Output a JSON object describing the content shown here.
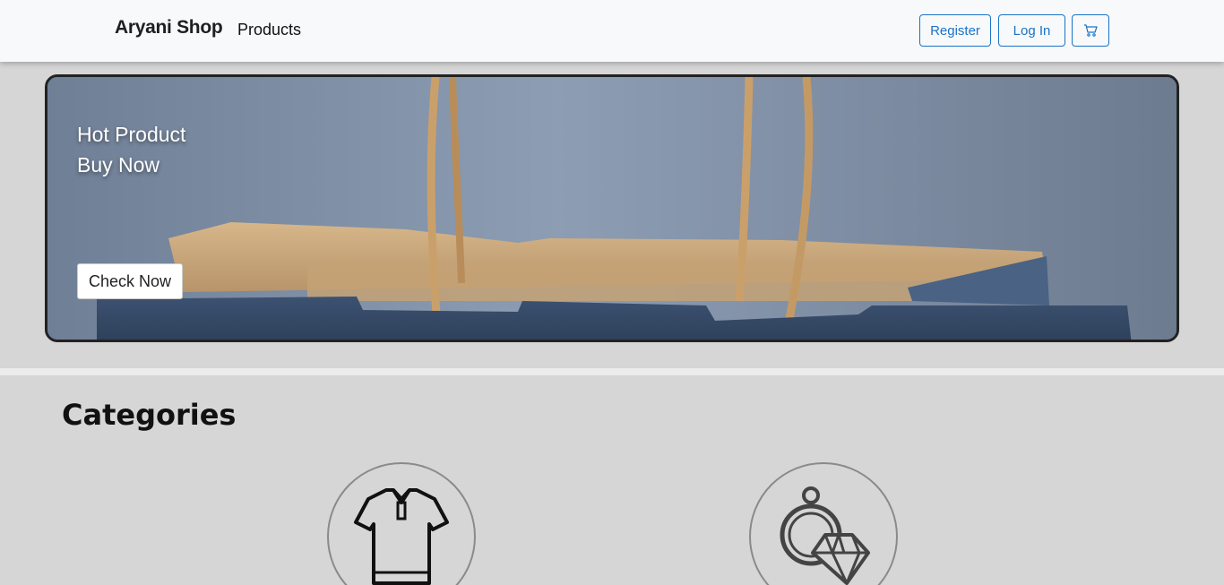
{
  "navbar": {
    "brand": "Aryani Shop",
    "products_link": "Products",
    "register_label": "Register",
    "login_label": "Log In",
    "cart_icon": "cart-icon"
  },
  "hero": {
    "line1": "Hot Product",
    "line2": "Buy Now",
    "button_label": "Check Now"
  },
  "categories": {
    "heading": "Categories",
    "items": [
      {
        "icon": "shirt-icon"
      },
      {
        "icon": "jewelry-icon"
      }
    ]
  },
  "colors": {
    "accent": "#1a73c8",
    "background": "#d6d6d6",
    "navbar": "#f8f9fa"
  }
}
